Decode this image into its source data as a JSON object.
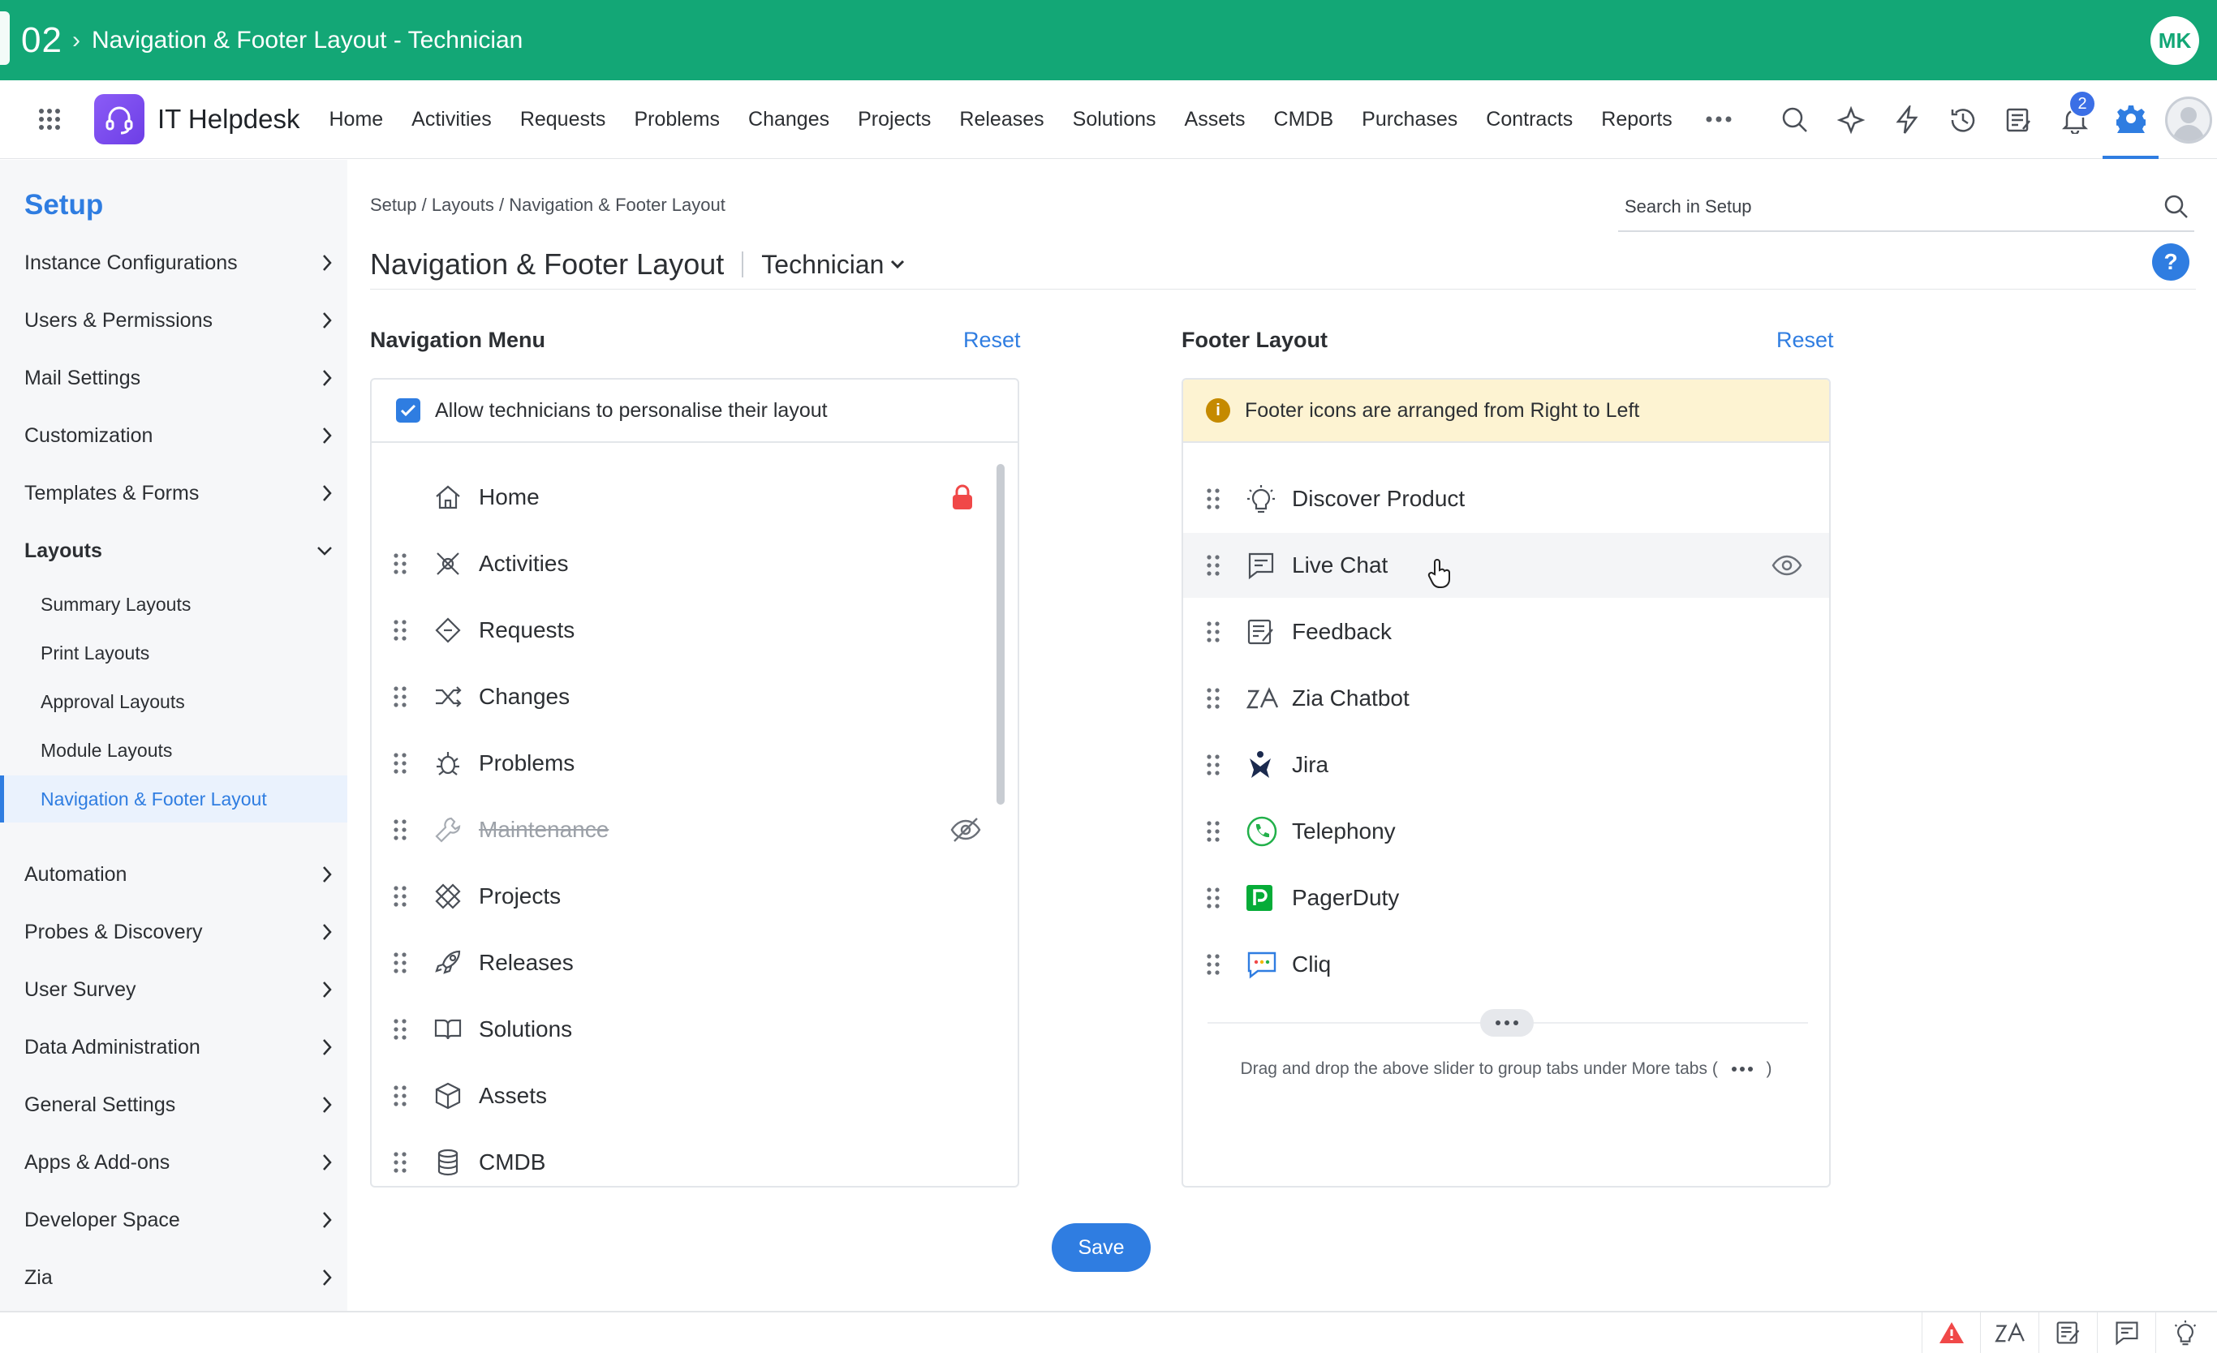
{
  "window": {
    "number": "02",
    "separator": "›",
    "title": "Navigation & Footer Layout - Technician",
    "user_initials": "MK"
  },
  "app": {
    "name": "IT Helpdesk",
    "nav": [
      "Home",
      "Activities",
      "Requests",
      "Problems",
      "Changes",
      "Projects",
      "Releases",
      "Solutions",
      "Assets",
      "CMDB",
      "Purchases",
      "Contracts",
      "Reports"
    ],
    "notification_count": "2",
    "tool_icons": [
      "search-icon",
      "sparkle-icon",
      "lightning-icon",
      "history-icon",
      "note-icon",
      "bell-icon",
      "gear-icon"
    ]
  },
  "sidebar": {
    "title": "Setup",
    "items_top": [
      "Instance Configurations",
      "Users & Permissions",
      "Mail Settings",
      "Customization",
      "Templates & Forms"
    ],
    "layouts_label": "Layouts",
    "layouts_sub": [
      "Summary Layouts",
      "Print Layouts",
      "Approval Layouts",
      "Module Layouts",
      "Navigation & Footer Layout"
    ],
    "active_sub": "Navigation & Footer Layout",
    "items_bottom": [
      "Automation",
      "Probes & Discovery",
      "User Survey",
      "Data Administration",
      "General Settings",
      "Apps & Add-ons",
      "Developer Space",
      "Zia"
    ]
  },
  "main": {
    "breadcrumb": "Setup / Layouts / Navigation & Footer Layout",
    "search_placeholder": "Search in Setup",
    "page_title": "Navigation & Footer Layout",
    "role": "Technician",
    "help": "?"
  },
  "navigation_menu": {
    "title": "Navigation Menu",
    "reset": "Reset",
    "allow_label": "Allow technicians to personalise their layout",
    "allow_checked": true,
    "items": [
      {
        "label": "Home",
        "icon": "home-icon",
        "state": "locked"
      },
      {
        "label": "Activities",
        "icon": "activities-icon",
        "state": "normal"
      },
      {
        "label": "Requests",
        "icon": "requests-icon",
        "state": "normal"
      },
      {
        "label": "Changes",
        "icon": "changes-icon",
        "state": "normal"
      },
      {
        "label": "Problems",
        "icon": "problems-icon",
        "state": "normal"
      },
      {
        "label": "Maintenance",
        "icon": "maintenance-icon",
        "state": "hidden"
      },
      {
        "label": "Projects",
        "icon": "projects-icon",
        "state": "normal"
      },
      {
        "label": "Releases",
        "icon": "releases-icon",
        "state": "normal"
      },
      {
        "label": "Solutions",
        "icon": "solutions-icon",
        "state": "normal"
      },
      {
        "label": "Assets",
        "icon": "assets-icon",
        "state": "normal"
      },
      {
        "label": "CMDB",
        "icon": "cmdb-icon",
        "state": "normal"
      }
    ]
  },
  "footer_layout": {
    "title": "Footer Layout",
    "reset": "Reset",
    "info": "Footer icons are arranged from Right to Left",
    "items": [
      {
        "label": "Discover Product",
        "icon": "bulb-icon"
      },
      {
        "label": "Live Chat",
        "icon": "chat-icon"
      },
      {
        "label": "Feedback",
        "icon": "feedback-icon"
      },
      {
        "label": "Zia Chatbot",
        "icon": "zia-icon"
      },
      {
        "label": "Jira",
        "icon": "jira-icon"
      },
      {
        "label": "Telephony",
        "icon": "telephony-icon"
      },
      {
        "label": "PagerDuty",
        "icon": "pagerduty-icon"
      },
      {
        "label": "Cliq",
        "icon": "cliq-icon"
      }
    ],
    "drag_hint": "Drag and drop the above slider to group tabs under More tabs (",
    "drag_hint_end": ")"
  },
  "actions": {
    "save": "Save"
  },
  "colors": {
    "brand_green": "#13a776",
    "accent_blue": "#2f7de1",
    "lock_red": "#f04848",
    "info_bg": "#fdf3d2"
  }
}
